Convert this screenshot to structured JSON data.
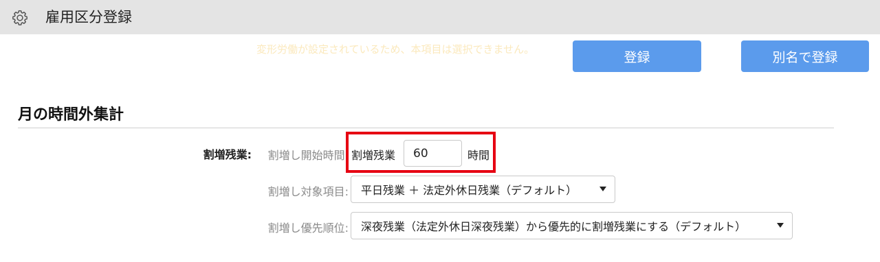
{
  "header": {
    "title": "雇用区分登録",
    "icon": "gear-icon"
  },
  "notice": "変形労働が設定されているため、本項目は選択できません。",
  "buttons": {
    "register": "登録",
    "register_alias": "別名で登録",
    "color": "#5b9bec"
  },
  "section": {
    "title": "月の時間外集計"
  },
  "overtime": {
    "row_label": "割増残業:",
    "start_label": "割増し開始時間:",
    "inner_label": "割増残業",
    "hours_value": "60",
    "unit": "時間",
    "highlight_color": "#e60012",
    "target_label": "割増し対象項目:",
    "target_selected": "平日残業 ＋ 法定外休日残業（デフォルト）",
    "priority_label": "割増し優先順位:",
    "priority_selected": "深夜残業（法定外休日深夜残業）から優先的に割増残業にする（デフォルト）"
  }
}
